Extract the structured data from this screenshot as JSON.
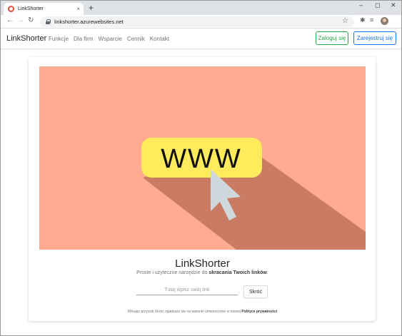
{
  "browser": {
    "tab_title": "LinkShorter",
    "tab_close": "×",
    "new_tab": "+",
    "url": "linkshorter.azurewebsites.net",
    "icons": [
      "back-arrow-icon",
      "forward-arrow-icon",
      "reload-icon",
      "lock-icon",
      "star-icon",
      "extensions-icon",
      "reading-list-icon",
      "profile-avatar-icon",
      "minimize-icon",
      "maximize-icon",
      "close-icon"
    ]
  },
  "navbar": {
    "brand": "LinkShorter",
    "links": [
      "Funkcje",
      "Dla firm",
      "Wsparcie",
      "Cennik",
      "Kontakt"
    ],
    "login_label": "Zaloguj się",
    "register_label": "Zarejestruj się"
  },
  "hero": {
    "sign_text": "WWW",
    "background_color": "#ffab91",
    "shadow_color": "#c97b64",
    "sign_color": "#ffeb5b",
    "cursor_color": "#cfd8dc"
  },
  "main": {
    "title": "LinkShorter",
    "subtitle_before": "Proste i użyteczne narzędzie do ",
    "subtitle_bold": "skracania Twoich linków",
    "subtitle_after": ".",
    "input_placeholder": "Tutaj wpisz swój link",
    "shorten_label": "Skróć",
    "footnote_before": "Klikając przycisk Skróć zgadzasz się na warunki umieszczone w naszej ",
    "footnote_bold": "Polityce prywatności"
  },
  "colors": {
    "login": "#28a745",
    "register": "#1a73e8"
  }
}
